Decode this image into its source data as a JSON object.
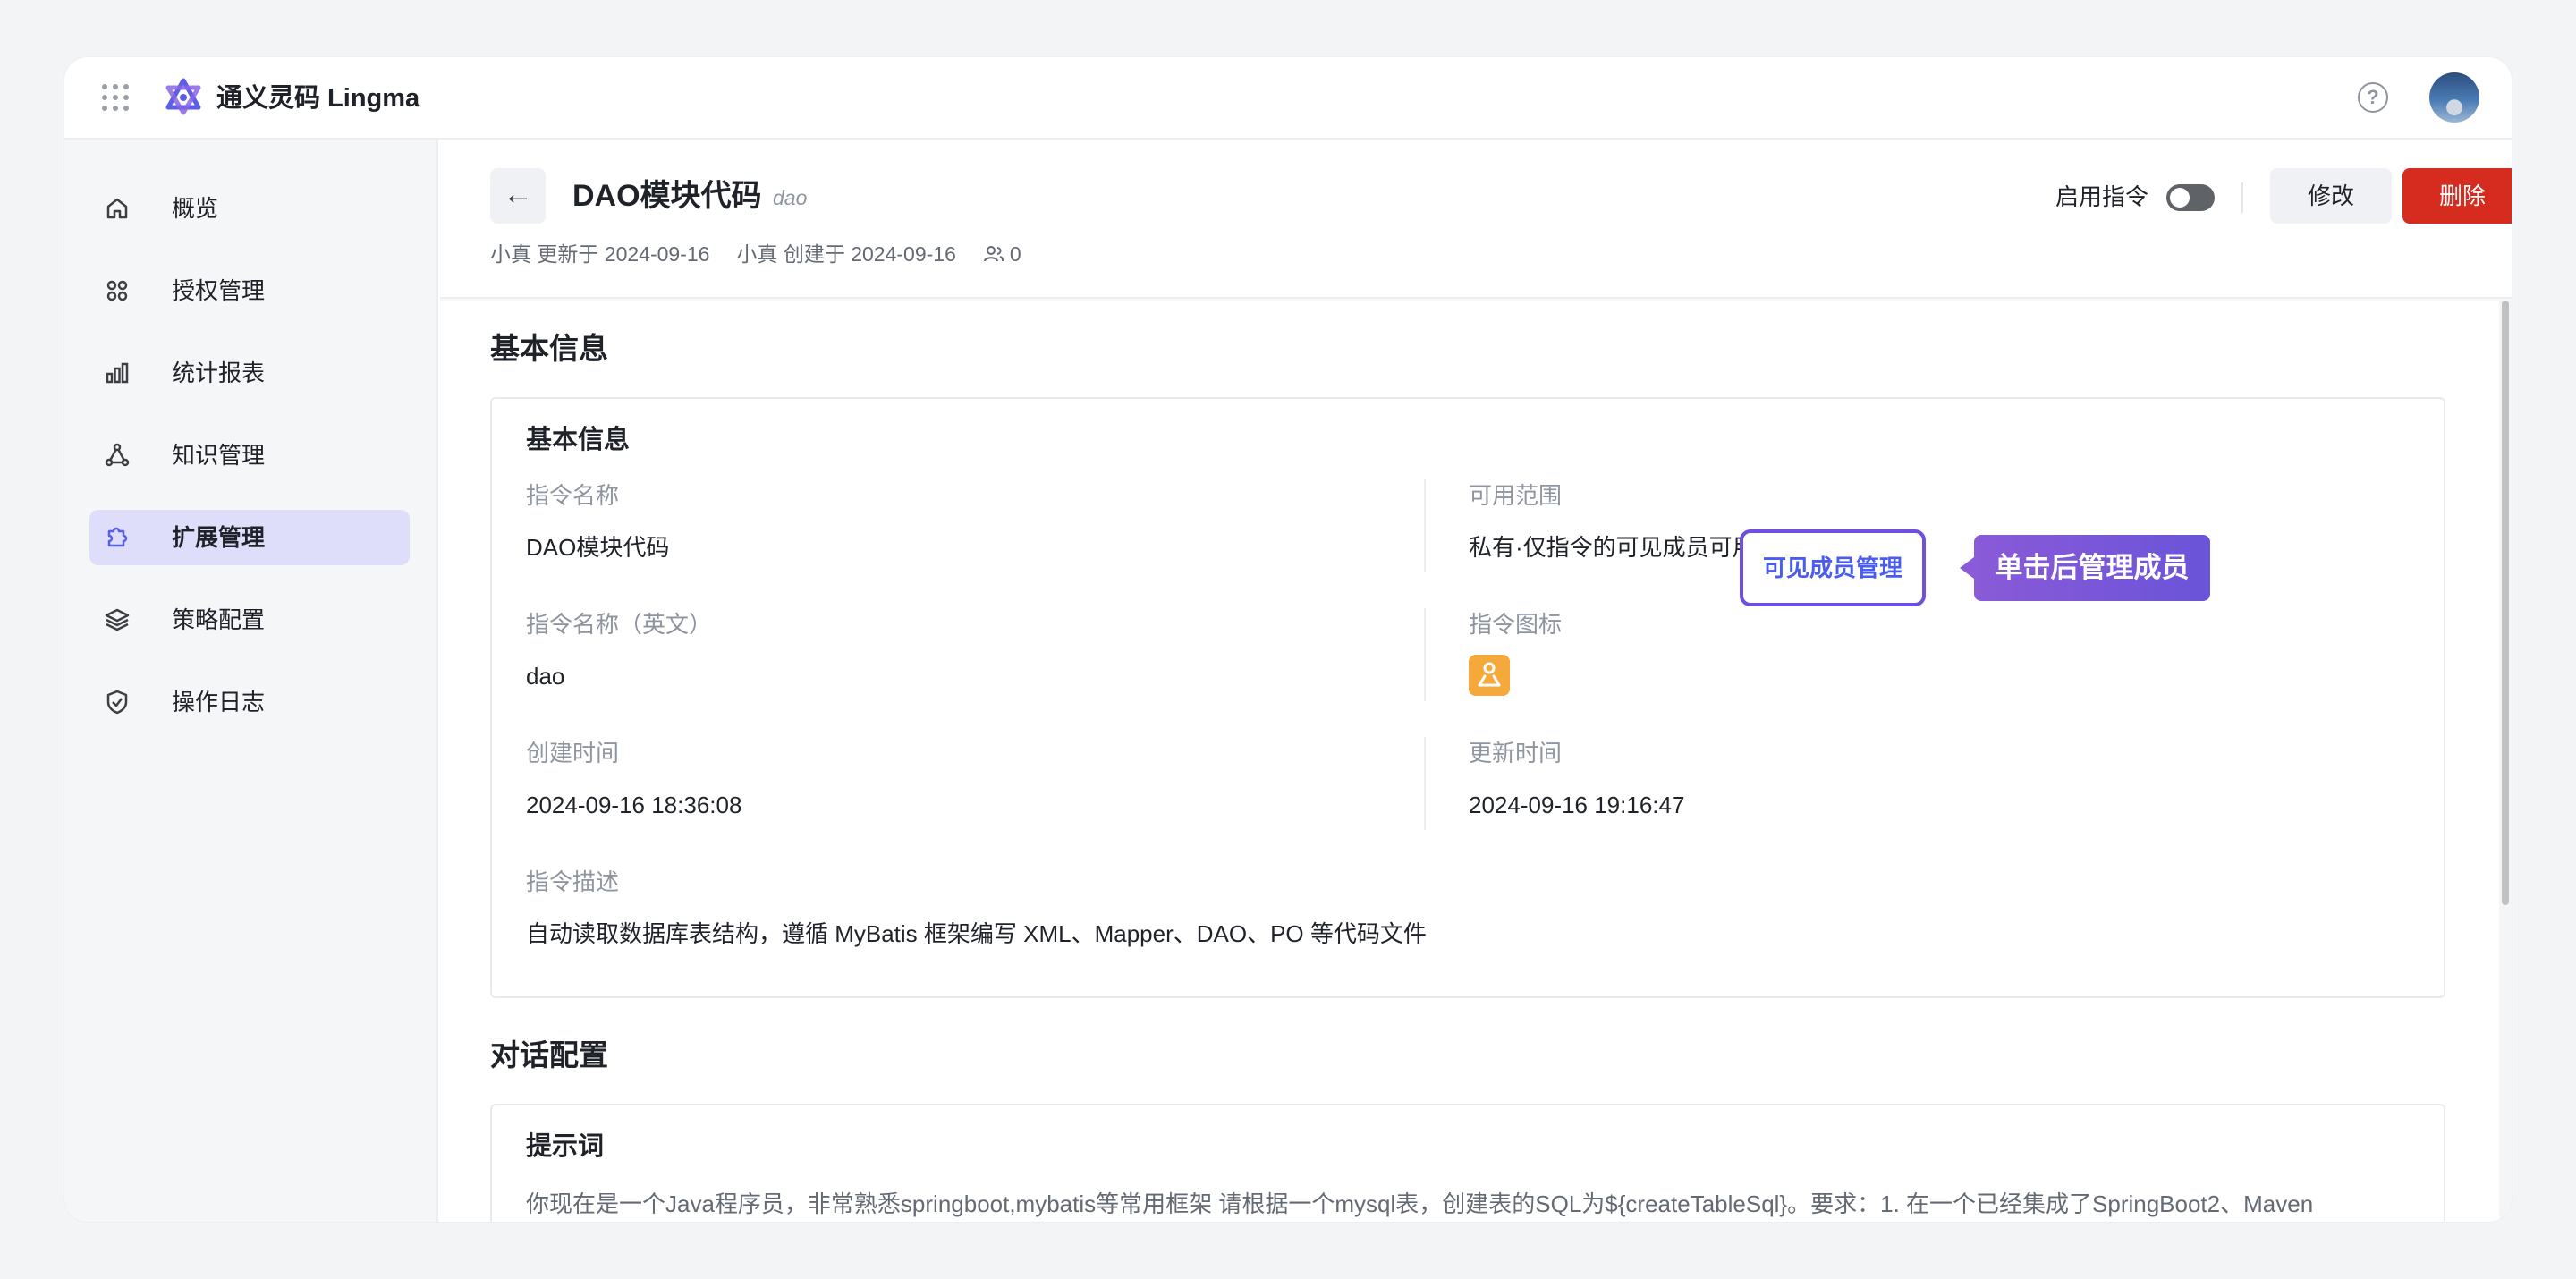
{
  "app": {
    "brand": "通义灵码 Lingma"
  },
  "colors": {
    "accent": "#6f4fe0",
    "danger": "#d52c1f",
    "active_bg": "#dedefb",
    "icon_orange": "#f5a93a"
  },
  "sidebar": {
    "items": [
      {
        "label": "概览",
        "icon": "home-icon"
      },
      {
        "label": "授权管理",
        "icon": "apps-icon"
      },
      {
        "label": "统计报表",
        "icon": "bar-chart-icon"
      },
      {
        "label": "知识管理",
        "icon": "nodes-icon"
      },
      {
        "label": "扩展管理",
        "icon": "puzzle-icon",
        "active": true
      },
      {
        "label": "策略配置",
        "icon": "layers-icon"
      },
      {
        "label": "操作日志",
        "icon": "shield-icon"
      }
    ]
  },
  "header": {
    "back_icon": "←",
    "title": "DAO模块代码",
    "tag": "dao",
    "updated": "小真 更新于 2024-09-16",
    "created": "小真 创建于 2024-09-16",
    "user_count": "0",
    "toggle_label": "启用指令",
    "toggle_on": false,
    "edit_label": "修改",
    "delete_label": "删除"
  },
  "basic_section": {
    "section_title": "基本信息",
    "card_title": "基本信息",
    "name_label": "指令名称",
    "name_value": "DAO模块代码",
    "scope_label": "可用范围",
    "scope_value": "私有·仅指令的可见成员可用 (0",
    "member_button": "可见成员管理",
    "tooltip": "单击后管理成员",
    "name_en_label": "指令名称（英文）",
    "name_en_value": "dao",
    "icon_label": "指令图标",
    "created_label": "创建时间",
    "created_value": "2024-09-16 18:36:08",
    "updated_label": "更新时间",
    "updated_value": "2024-09-16 19:16:47",
    "desc_label": "指令描述",
    "desc_value": "自动读取数据库表结构，遵循 MyBatis 框架编写 XML、Mapper、DAO、PO 等代码文件"
  },
  "dialog_section": {
    "section_title": "对话配置",
    "card_title": "提示词",
    "prompt_text": "你现在是一个Java程序员，非常熟悉springboot,mybatis等常用框架 请根据一个mysql表，创建表的SQL为${createTableSql}。要求：1. 在一个已经集成了SpringBoot2、Maven"
  }
}
